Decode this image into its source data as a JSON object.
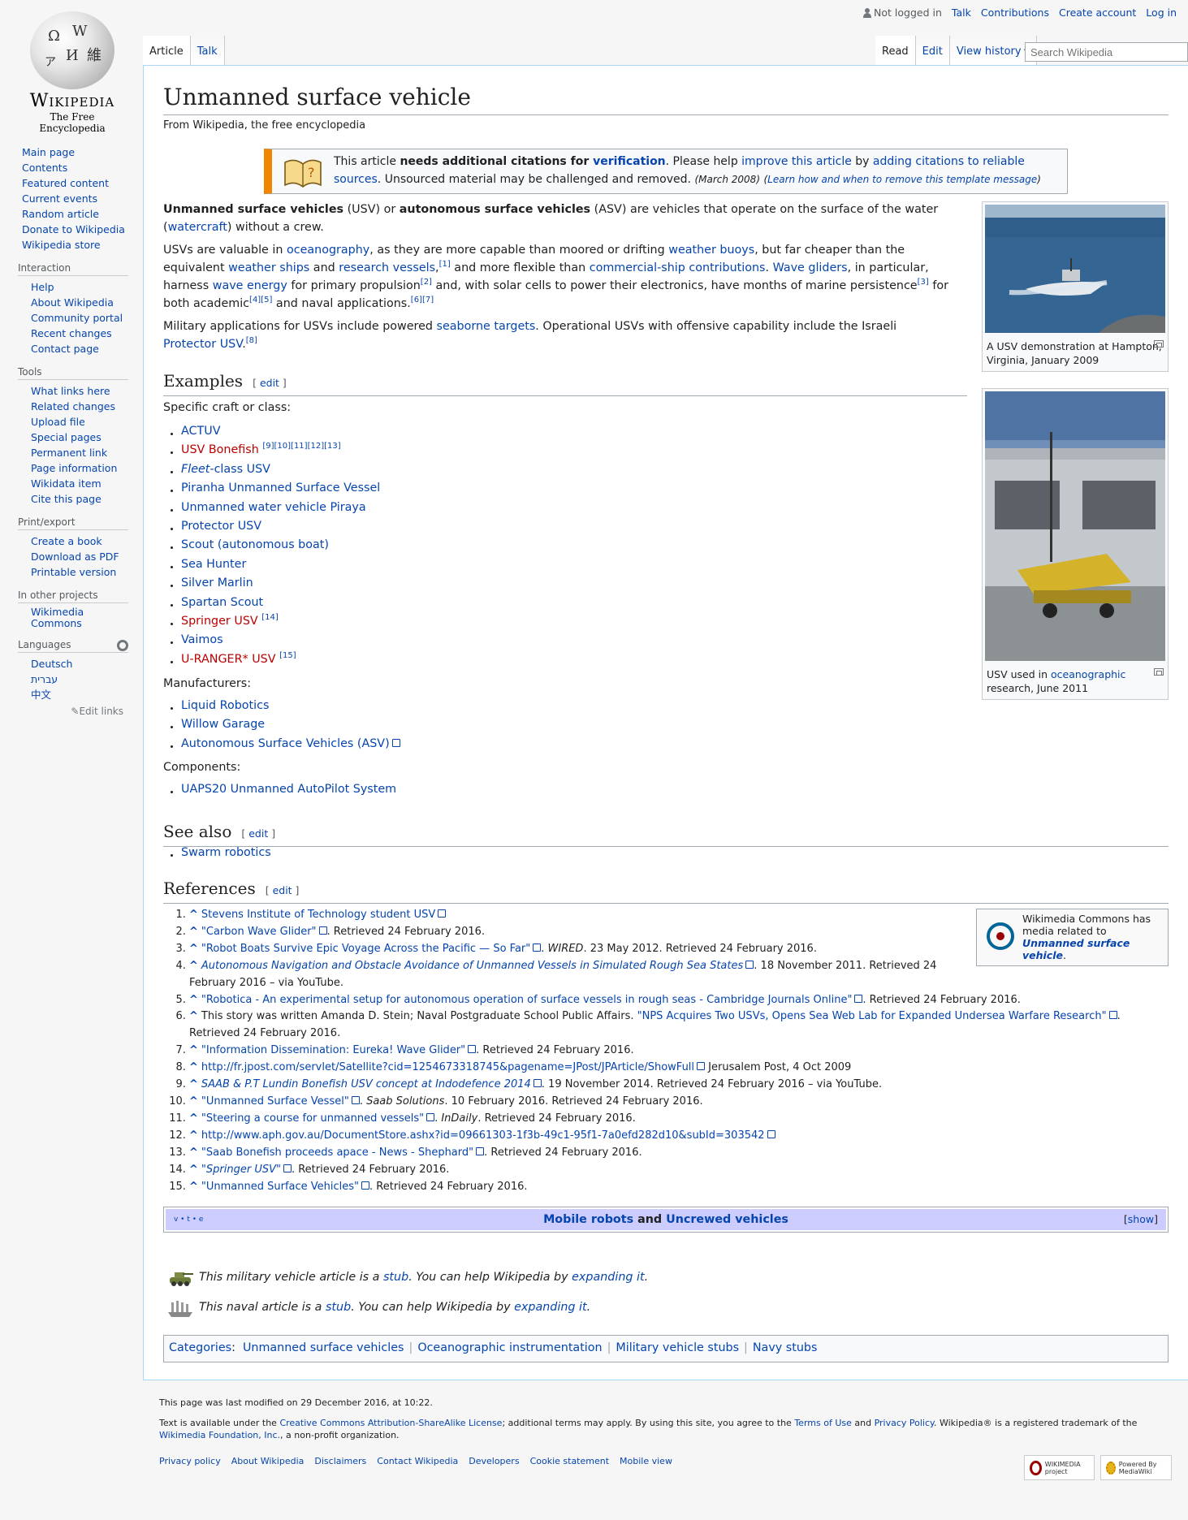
{
  "personal": {
    "not_logged_in": "Not logged in",
    "talk": "Talk",
    "contributions": "Contributions",
    "create_account": "Create account",
    "log_in": "Log in"
  },
  "logo": {
    "wordmark": "Wikipedia",
    "tagline": "The Free Encyclopedia"
  },
  "tabs": {
    "article": "Article",
    "talk": "Talk",
    "read": "Read",
    "edit": "Edit",
    "view_history": "View history"
  },
  "search": {
    "placeholder": "Search Wikipedia"
  },
  "sidebar": {
    "main": [
      "Main page",
      "Contents",
      "Featured content",
      "Current events",
      "Random article",
      "Donate to Wikipedia",
      "Wikipedia store"
    ],
    "interaction": {
      "title": "Interaction",
      "items": [
        "Help",
        "About Wikipedia",
        "Community portal",
        "Recent changes",
        "Contact page"
      ]
    },
    "tools": {
      "title": "Tools",
      "items": [
        "What links here",
        "Related changes",
        "Upload file",
        "Special pages",
        "Permanent link",
        "Page information",
        "Wikidata item",
        "Cite this page"
      ]
    },
    "print": {
      "title": "Print/export",
      "items": [
        "Create a book",
        "Download as PDF",
        "Printable version"
      ]
    },
    "projects": {
      "title": "In other projects",
      "items": [
        "Wikimedia Commons"
      ]
    },
    "languages": {
      "title": "Languages",
      "items": [
        "Deutsch",
        "עברית",
        "中文"
      ],
      "edit_links": "Edit links"
    }
  },
  "article": {
    "title": "Unmanned surface vehicle",
    "site_sub": "From Wikipedia, the free encyclopedia",
    "ambox": {
      "t1": "This article ",
      "bold": "needs additional citations for ",
      "verification": "verification",
      "t2": ". Please help ",
      "improve": "improve this article",
      "t3": " by ",
      "adding": "adding citations to reliable sources",
      "t4": ". Unsourced material may be challenged and removed. ",
      "date": "(March 2008)",
      "learn_pre": "(",
      "learn": "Learn how and when to remove this template message",
      "learn_post": ")"
    },
    "p1": {
      "b1": "Unmanned surface vehicles",
      "t1": " (USV) or ",
      "b2": "autonomous surface vehicles",
      "t2": " (ASV) are vehicles that operate on the surface of the water (",
      "l1": "watercraft",
      "t3": ") without a crew."
    },
    "p2": {
      "t1": "USVs are valuable in ",
      "l1": "oceanography",
      "t2": ", as they are more capable than moored or drifting ",
      "l2": "weather buoys",
      "t3": ", but far cheaper than the equivalent ",
      "l3": "weather ships",
      "t4": " and ",
      "l4": "research vessels",
      "t4b": ",",
      "r1": "[1]",
      "t5": " and more flexible than ",
      "l5": "commercial-ship contributions",
      "t6": ". ",
      "l6": "Wave gliders",
      "t7": ", in particular, harness ",
      "l7": "wave energy",
      "t8": " for primary propulsion",
      "r2": "[2]",
      "t9": " and, with solar cells to power their electronics, have months of marine persistence",
      "r3": "[3]",
      "t10": " for both academic",
      "r4": "[4]",
      "r5": "[5]",
      "t11": " and naval applications.",
      "r6": "[6]",
      "r7": "[7]"
    },
    "p3": {
      "t1": "Military applications for USVs include powered ",
      "l1": "seaborne targets",
      "t2": ". Operational USVs with offensive capability include the Israeli ",
      "l2": "Protector USV",
      "t3": ".",
      "r8": "[8]"
    },
    "examples": {
      "heading": "Examples",
      "edit": "edit",
      "specific_label": "Specific craft or class:",
      "craft": [
        {
          "label": "ACTUV",
          "refs": ""
        },
        {
          "label": "USV Bonefish",
          "refs": "[9][10][11][12][13]"
        },
        {
          "label_it": "Fleet",
          "label": "-class USV",
          "refs": ""
        },
        {
          "label": "Piranha Unmanned Surface Vessel",
          "refs": ""
        },
        {
          "label": "Unmanned water vehicle Piraya",
          "refs": ""
        },
        {
          "label": "Protector USV",
          "refs": ""
        },
        {
          "label": "Scout (autonomous boat)",
          "refs": ""
        },
        {
          "label": "Sea Hunter",
          "refs": ""
        },
        {
          "label": "Silver Marlin",
          "refs": ""
        },
        {
          "label": "Spartan Scout",
          "refs": ""
        },
        {
          "label": "Springer USV",
          "refs": "[14]"
        },
        {
          "label": "Vaimos",
          "refs": ""
        },
        {
          "label": "U-RANGER* USV",
          "refs": "[15]"
        }
      ],
      "manufacturers_label": "Manufacturers:",
      "manufacturers": [
        "Liquid Robotics",
        "Willow Garage",
        "Autonomous Surface Vehicles (ASV)"
      ],
      "components_label": "Components:",
      "components": [
        "UAPS20 Unmanned AutoPilot System"
      ]
    },
    "see_also": {
      "heading": "See also",
      "edit": "edit",
      "items": [
        "Swarm robotics"
      ]
    },
    "references": {
      "heading": "References",
      "edit": "edit",
      "items": [
        {
          "link": "Stevens Institute of Technology student USV",
          "rest": ""
        },
        {
          "link": "\"Carbon Wave Glider\"",
          "rest": ". Retrieved 24 February 2016."
        },
        {
          "link": "\"Robot Boats Survive Epic Voyage Across the Pacific — So Far\"",
          "rest_it": "WIRED",
          "rest": ". 23 May 2012. Retrieved 24 February 2016."
        },
        {
          "link_it": "Autonomous Navigation and Obstacle Avoidance of Unmanned Vessels in Simulated Rough Sea States",
          "rest": ". 18 November 2011. Retrieved 24 February 2016 – via YouTube."
        },
        {
          "link": "\"Robotica - An experimental setup for autonomous operation of surface vessels in rough seas - Cambridge Journals Online\"",
          "rest": ". Retrieved 24 February 2016."
        },
        {
          "pre": "This story was written Amanda D. Stein; Naval Postgraduate School Public Affairs. ",
          "link": "\"NPS Acquires Two USVs, Opens Sea Web Lab for Expanded Undersea Warfare Research\"",
          "rest": ". Retrieved 24 February 2016."
        },
        {
          "link": "\"Information Dissemination: Eureka! Wave Glider\"",
          "rest": ". Retrieved 24 February 2016."
        },
        {
          "link": "http://fr.jpost.com/servlet/Satellite?cid=1254673318745&pagename=JPost/JPArticle/ShowFull",
          "rest": " Jerusalem Post, 4 Oct 2009"
        },
        {
          "link_it": "SAAB & P.T Lundin Bonefish USV concept at Indodefence 2014",
          "rest": ". 19 November 2014. Retrieved 24 February 2016 – via YouTube."
        },
        {
          "link": "\"Unmanned Surface Vessel\"",
          "rest_it": "Saab Solutions",
          "rest": ". 10 February 2016. Retrieved 24 February 2016."
        },
        {
          "link": "\"Steering a course for unmanned vessels\"",
          "rest_it": "InDaily",
          "rest": ". Retrieved 24 February 2016."
        },
        {
          "link": "http://www.aph.gov.au/DocumentStore.ashx?id=09661303-1f3b-49c1-95f1-7a0efd282d10&subId=303542",
          "rest": ""
        },
        {
          "link": "\"Saab Bonefish proceeds apace - News - Shephard\"",
          "rest": ". Retrieved 24 February 2016."
        },
        {
          "link_it_q": "Springer USV",
          "rest": ". Retrieved 24 February 2016."
        },
        {
          "link": "\"Unmanned Surface Vehicles\"",
          "rest": ". Retrieved 24 February 2016."
        }
      ]
    },
    "thumb1": {
      "caption": "A USV demonstration at Hampton, Virginia, January 2009"
    },
    "thumb2": {
      "caption_pre": "USV used in ",
      "caption_link": "oceanographic",
      "caption_post": " research, June 2011"
    },
    "commons": {
      "t1": "Wikimedia Commons has media related to ",
      "link": "Unmanned surface vehicle",
      "t2": "."
    },
    "navbox": {
      "vte": "v • t • e",
      "l1": "Mobile robots",
      "and": " and ",
      "l2": "Uncrewed vehicles",
      "show": "show"
    },
    "stubs": [
      {
        "t1": "This military vehicle article is a ",
        "l1": "stub",
        "t2": ". You can help Wikipedia by ",
        "l2": "expanding it",
        "t3": "."
      },
      {
        "t1": "This naval article is a ",
        "l1": "stub",
        "t2": ". You can help Wikipedia by ",
        "l2": "expanding it",
        "t3": "."
      }
    ],
    "categories": {
      "label": "Categories",
      "items": [
        "Unmanned surface vehicles",
        "Oceanographic instrumentation",
        "Military vehicle stubs",
        "Navy stubs"
      ]
    }
  },
  "footer": {
    "modified": "This page was last modified on 29 December 2016, at 10:22.",
    "license_t1": "Text is available under the ",
    "license_l1": "Creative Commons Attribution-ShareAlike License",
    "license_t2": "; additional terms may apply. By using this site, you agree to the ",
    "license_l2": "Terms of Use",
    "license_t3": " and ",
    "license_l3": "Privacy Policy",
    "license_t4": ". Wikipedia® is a registered trademark of the ",
    "license_l4": "Wikimedia Foundation, Inc.",
    "license_t5": ", a non-profit organization.",
    "places": [
      "Privacy policy",
      "About Wikipedia",
      "Disclaimers",
      "Contact Wikipedia",
      "Developers",
      "Cookie statement",
      "Mobile view"
    ],
    "badge1": "WIKIMEDIA project",
    "badge2": "Powered By MediaWiki"
  },
  "colors": {
    "link": "#0645ad",
    "redlink": "#ba0000",
    "ambox_accent": "#f28500",
    "navbox": "#ccccff"
  }
}
